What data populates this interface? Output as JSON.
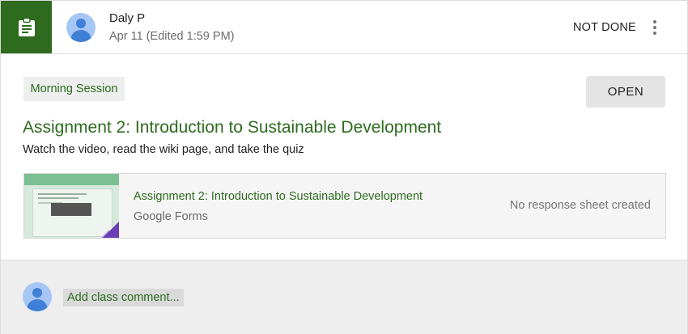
{
  "header": {
    "author_name": "Daly P",
    "post_date": "Apr 11 (Edited 1:59 PM)",
    "status": "NOT DONE",
    "tile_icon": "assignment-clipboard-icon",
    "more_icon": "more-vertical-icon"
  },
  "assignment": {
    "topic": "Morning Session",
    "open_label": "OPEN",
    "title": "Assignment 2: Introduction to Sustainable Development",
    "description": "Watch the video, read the wiki page, and take the quiz"
  },
  "attachment": {
    "title": "Assignment 2: Introduction to Sustainable Development",
    "type": "Google Forms",
    "status": "No response sheet created"
  },
  "comments": {
    "add_placeholder": "Add class comment..."
  },
  "colors": {
    "accent_green": "#2e6b1f",
    "avatar_blue": "#3f7fd6"
  }
}
